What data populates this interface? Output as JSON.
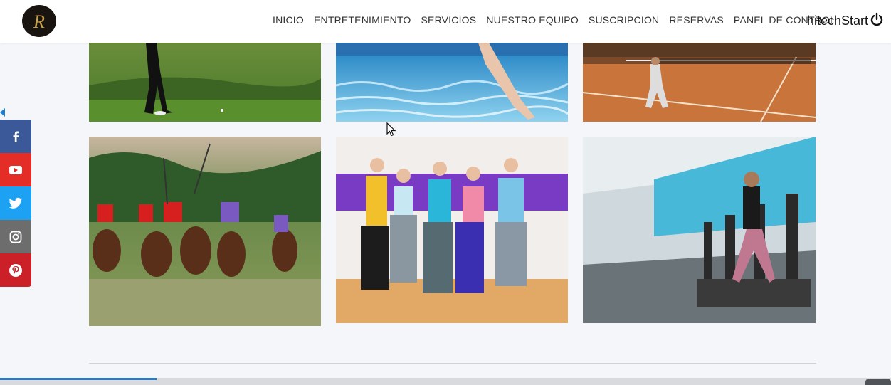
{
  "header": {
    "logo_letter": "R",
    "nav": [
      "INICIO",
      "ENTRETENIMIENTO",
      "SERVICIOS",
      "NUESTRO EQUIPO",
      "SUSCRIPCION",
      "RESERVAS",
      "PANEL DE CONTROL"
    ],
    "brand": "hitechStart",
    "brand_icon": "power-icon"
  },
  "gallery": {
    "tiles": [
      {
        "subject": "golf"
      },
      {
        "subject": "swimming pool"
      },
      {
        "subject": "tennis court"
      },
      {
        "subject": "polo"
      },
      {
        "subject": "dance / zumba class"
      },
      {
        "subject": "gym treadmills"
      }
    ]
  },
  "social": {
    "items": [
      {
        "icon": "facebook-icon",
        "color": "#3b5998"
      },
      {
        "icon": "youtube-icon",
        "color": "#e52d27"
      },
      {
        "icon": "twitter-icon",
        "color": "#1da1f2"
      },
      {
        "icon": "instagram-icon",
        "color": "#6d6d6d"
      },
      {
        "icon": "pinterest-icon",
        "color": "#cb2027"
      }
    ]
  },
  "colors": {
    "background": "#f4f6f9",
    "accent": "#1f7fd1"
  }
}
